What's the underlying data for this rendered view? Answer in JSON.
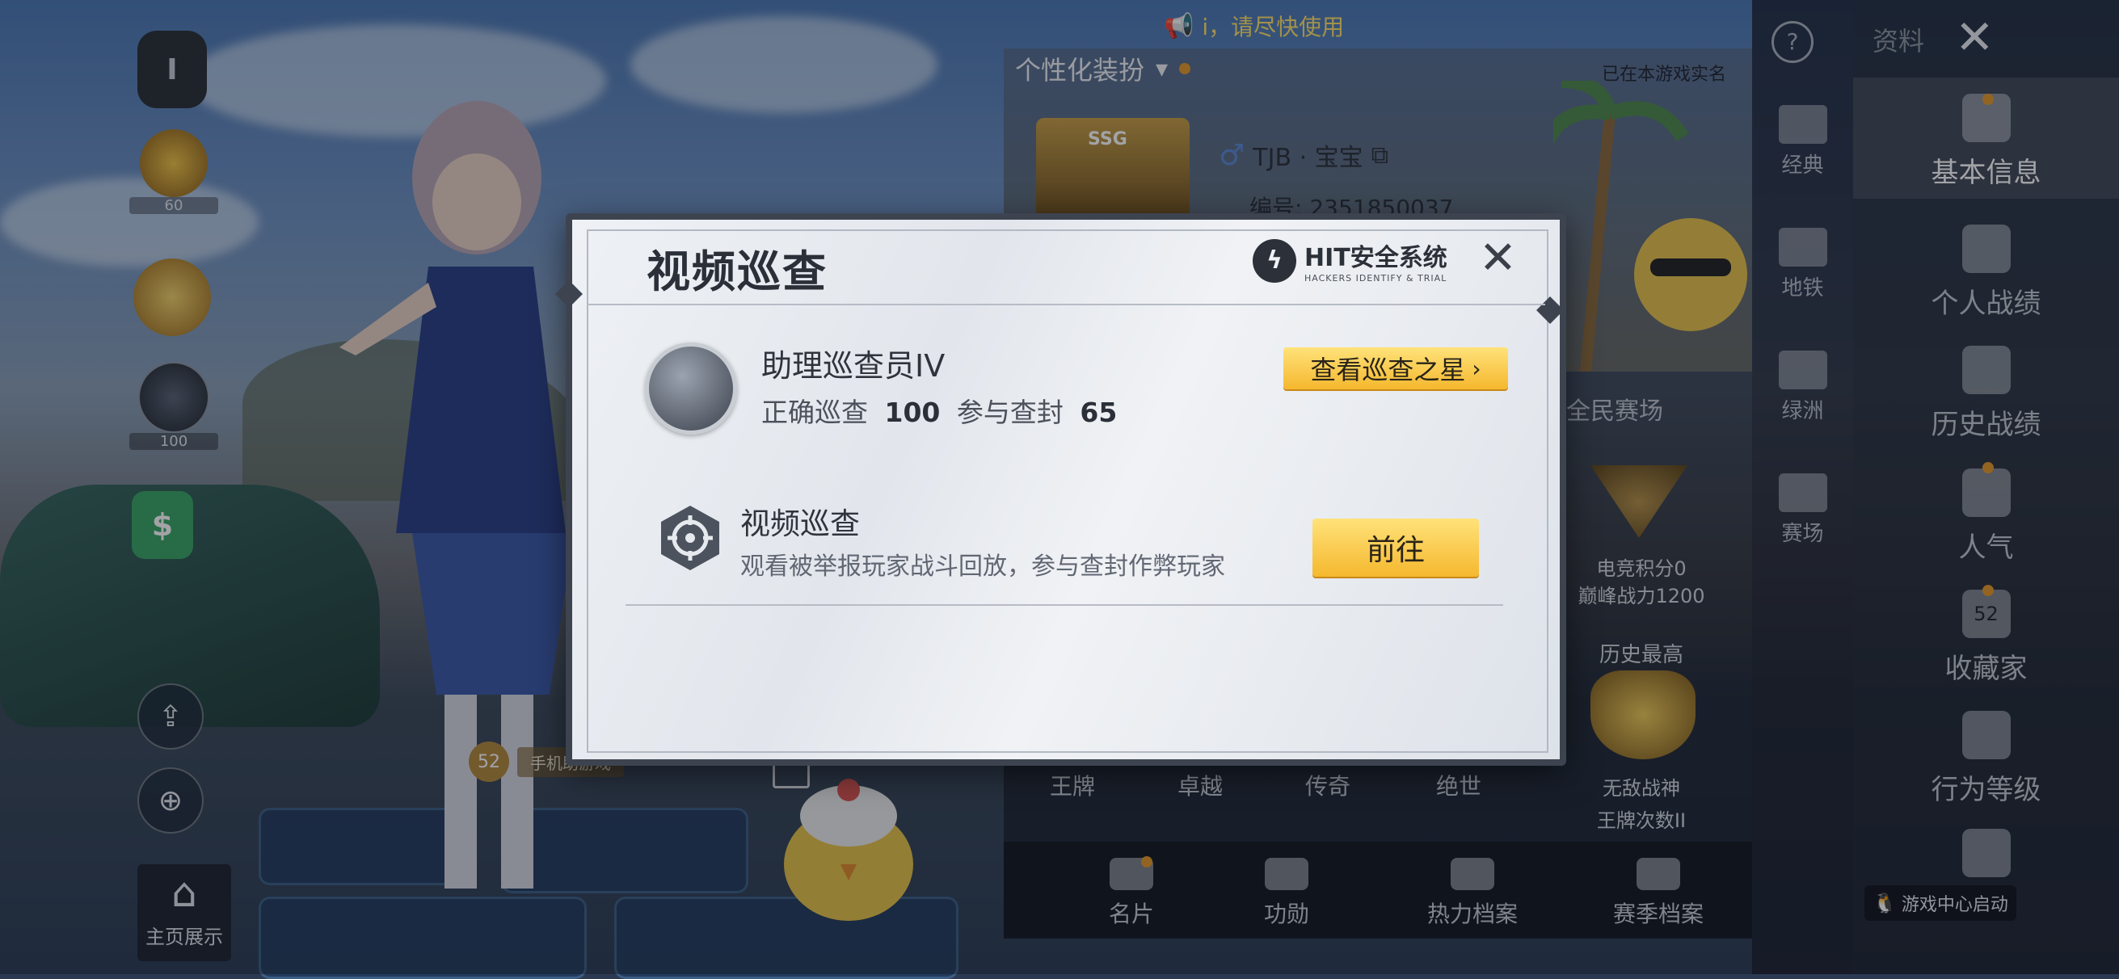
{
  "notice": {
    "text": "i，请尽快使用"
  },
  "left_column": {
    "level_badge_caption": "60",
    "weapon_badge_caption": "100",
    "level_tag": "52",
    "level_tag_name": "手机助游戏"
  },
  "homepage_button": {
    "label": "主页展示"
  },
  "profile": {
    "personalize_label": "个性化装扮",
    "verified_text": "已在本游戏实名",
    "rank_badge": "SSG",
    "player_name": "TJB · 宝宝",
    "player_id": "编号: 2351850037",
    "arena_label": "全民赛场",
    "esports_points": "电竞积分0",
    "peak_power": "巅峰战力1200",
    "history_best_label": "历史最高",
    "best_rank_title": "无敌战神",
    "best_rank_count": "王牌次数II",
    "rank_tabs": [
      "王牌",
      "卓越",
      "传奇",
      "绝世"
    ]
  },
  "bottom_bar": {
    "items": [
      {
        "label": "名片",
        "icon": "card-icon"
      },
      {
        "label": "功勋",
        "icon": "medal-icon"
      },
      {
        "label": "热力档案",
        "icon": "flame-icon"
      },
      {
        "label": "赛季档案",
        "icon": "season-icon"
      }
    ]
  },
  "sidebar_small": {
    "items": [
      {
        "label": "经典",
        "icon": "classic-icon"
      },
      {
        "label": "地铁",
        "icon": "metro-icon"
      },
      {
        "label": "绿洲",
        "icon": "oasis-icon"
      },
      {
        "label": "赛场",
        "icon": "arena-icon"
      }
    ]
  },
  "sidebar_big": {
    "header_label": "资料",
    "items": [
      {
        "label": "基本信息",
        "icon": "user-icon",
        "active": true
      },
      {
        "label": "个人战绩",
        "icon": "stats-icon"
      },
      {
        "label": "历史战绩",
        "icon": "history-icon"
      },
      {
        "label": "人气",
        "icon": "popularity-icon"
      },
      {
        "label": "收藏家",
        "icon": "collector-icon",
        "badge": "52"
      },
      {
        "label": "行为等级",
        "icon": "behavior-icon"
      },
      {
        "label": "",
        "icon": "document-icon"
      }
    ],
    "game_center_label": "游戏中心启动"
  },
  "dialog": {
    "title": "视频巡查",
    "hit_logo_text": "HIT安全系统",
    "hit_logo_sub": "HACKERS IDENTIFY & TRIAL",
    "rank_title": "助理巡查员IV",
    "correct_label": "正确巡查",
    "correct_value": "100",
    "ban_label": "参与查封",
    "ban_value": "65",
    "view_star_button": "查看巡查之星",
    "item": {
      "title": "视频巡查",
      "description": "观看被举报玩家战斗回放，参与查封作弊玩家",
      "go_button": "前往"
    }
  },
  "colors": {
    "gold_button": "#f5b82e",
    "accent_dot": "#e59a2b",
    "dialog_bg": "#eef1f5"
  }
}
